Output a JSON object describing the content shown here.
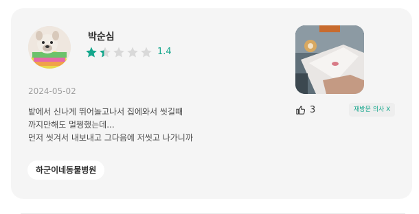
{
  "review": {
    "author": "박순심",
    "rating": 1.4,
    "rating_text": "1.4",
    "stars_max": 5,
    "date": "2024-05-02",
    "body_lines": [
      "밭에서 신나게 뛰어놀고나서 집에와서 씻길때",
      "까지만해도 멀쩡했는데...",
      "먼저 씻겨서 내보내고 그다음에 저씻고 나가니까"
    ],
    "hospital": "하군이네동물병원",
    "likes": "3",
    "revisit_badge": "재방문 의사 X"
  },
  "colors": {
    "accent": "#14a78c",
    "star_empty": "#d9d9d9",
    "card_bg": "#f5f5f5"
  },
  "icons": {
    "avatar": "dog-photo-avatar",
    "photo": "review-photo",
    "likes": "thumbs-up-icon"
  }
}
